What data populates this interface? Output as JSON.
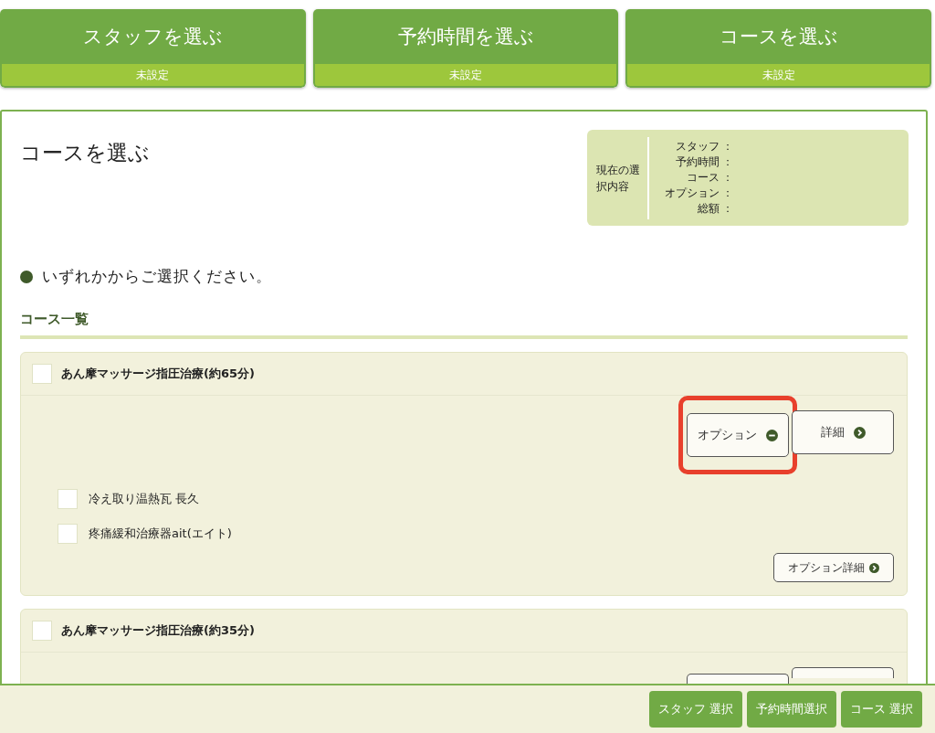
{
  "steps": [
    {
      "title": "スタッフを選ぶ",
      "status": "未設定"
    },
    {
      "title": "予約時間を選ぶ",
      "status": "未設定"
    },
    {
      "title": "コースを選ぶ",
      "status": "未設定"
    }
  ],
  "page_title": "コースを選ぶ",
  "summary": {
    "heading": "現在の選択内容",
    "rows": [
      {
        "label": "スタッフ",
        "sep": "："
      },
      {
        "label": "予約時間",
        "sep": "："
      },
      {
        "label": "コース",
        "sep": "："
      },
      {
        "label": "オプション",
        "sep": "："
      },
      {
        "label": "総額",
        "sep": "："
      }
    ]
  },
  "instruction": "いずれかからご選択ください。",
  "section_title": "コース一覧",
  "courses": [
    {
      "name": "あん摩マッサージ指圧治療(約65分)",
      "checked": false,
      "expanded": true,
      "option_button": "オプション",
      "option_highlighted": true,
      "detail_button": "詳細",
      "options": [
        {
          "label": "冷え取り温熱瓦 長久",
          "checked": false
        },
        {
          "label": "疼痛緩和治療器ait(エイト)",
          "checked": false
        }
      ],
      "option_detail_button": "オプション詳細"
    },
    {
      "name": "あん摩マッサージ指圧治療(約35分)",
      "checked": false,
      "expanded": false,
      "option_highlighted": false
    }
  ],
  "footer_buttons": [
    "スタッフ 選択",
    "予約時間選択",
    "コース 選択"
  ]
}
